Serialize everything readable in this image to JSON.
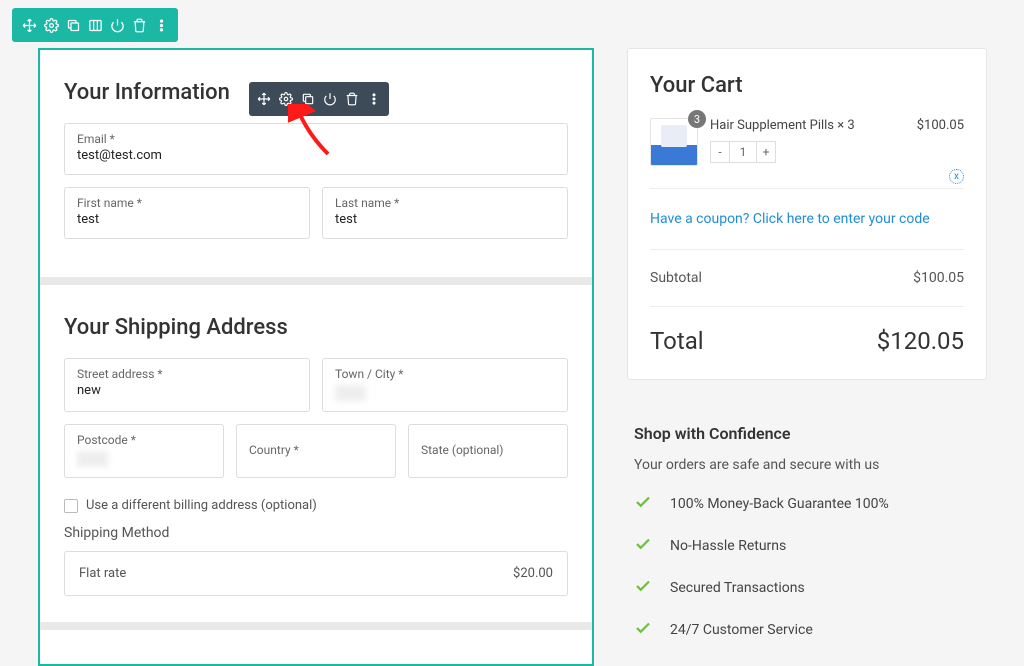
{
  "tooltip": "Module Settings",
  "info": {
    "heading": "Your Information",
    "email_label": "Email *",
    "email_value": "test@test.com",
    "first_label": "First name *",
    "first_value": "test",
    "last_label": "Last name *",
    "last_value": "test"
  },
  "ship": {
    "heading": "Your Shipping Address",
    "street_label": "Street address *",
    "street_value": "new",
    "town_label": "Town / City *",
    "postcode_label": "Postcode *",
    "country_label": "Country *",
    "state_label": "State (optional)",
    "diff_billing": "Use a different billing address (optional)",
    "method_label": "Shipping Method",
    "method_name": "Flat rate",
    "method_price": "$20.00"
  },
  "cart": {
    "heading": "Your Cart",
    "item_name": "Hair Supplement Pills × 3",
    "item_badge": "3",
    "item_qty": "1",
    "item_price": "$100.05",
    "coupon": "Have a coupon? Click here to enter your code",
    "subtotal_label": "Subtotal",
    "subtotal_value": "$100.05",
    "total_label": "Total",
    "total_value": "$120.05"
  },
  "confidence": {
    "heading": "Shop with Confidence",
    "sub": "Your orders are safe and secure with us",
    "items": [
      "100% Money-Back Guarantee 100%",
      "No-Hassle Returns",
      "Secured Transactions",
      "24/7 Customer Service"
    ]
  }
}
